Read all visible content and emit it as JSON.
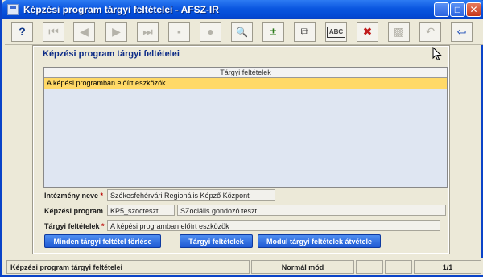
{
  "window": {
    "title": "Képzési program tárgyi feltételei - AFSZ-IR"
  },
  "titlebar_buttons": {
    "minimize": "_",
    "maximize": "□",
    "close": "✕"
  },
  "toolbar": {
    "icons": [
      {
        "name": "help-icon",
        "glyph": "?"
      },
      {
        "name": "first-record-icon",
        "glyph": "⏮"
      },
      {
        "name": "previous-record-icon",
        "glyph": "◀"
      },
      {
        "name": "next-record-icon",
        "glyph": "▶"
      },
      {
        "name": "last-record-icon",
        "glyph": "⏭"
      },
      {
        "name": "save-icon",
        "glyph": "▪"
      },
      {
        "name": "undo-icon",
        "glyph": "●"
      },
      {
        "name": "search-icon",
        "glyph": "🔍"
      },
      {
        "name": "add-record-icon",
        "glyph": "±"
      },
      {
        "name": "copy-icon",
        "glyph": "⧉"
      },
      {
        "name": "abc-list-icon",
        "glyph": "ABC"
      },
      {
        "name": "delete-record-icon",
        "glyph": "✖"
      },
      {
        "name": "print-icon",
        "glyph": "▩"
      },
      {
        "name": "back-arrow-icon",
        "glyph": "↶"
      },
      {
        "name": "exit-icon",
        "glyph": "⇦"
      }
    ]
  },
  "panel": {
    "title": "Képzési program tárgyi feltételei"
  },
  "grid": {
    "header": "Tárgyi feltételek",
    "rows": [
      "A képési programban előírt eszközök"
    ]
  },
  "form": {
    "institution_label": "Intézmény neve",
    "institution_required": "*",
    "institution_value": "Székesfehérvári Regionális Képző Központ",
    "program_label": "Képzési program",
    "program_code": "KP5_szocteszt",
    "program_name": "SZociális gondozó teszt",
    "conditions_label": "Tárgyi feltételek",
    "conditions_required": "*",
    "conditions_value": "A képési programban előírt eszközök"
  },
  "buttons": {
    "delete_all": "Minden tárgyi feltétel törlése",
    "conditions": "Tárgyi feltételek",
    "import_module": "Modul tárgyi feltételek átvétele"
  },
  "status": {
    "screen_name": "Képzési program tárgyi feltételei",
    "mode": "Normál mód",
    "record": "1/1"
  },
  "colors": {
    "title_blue": "#0a56e0",
    "selected_row": "#ffd967",
    "button_blue": "#1f5ad4",
    "panel_title": "#0b2a86"
  }
}
